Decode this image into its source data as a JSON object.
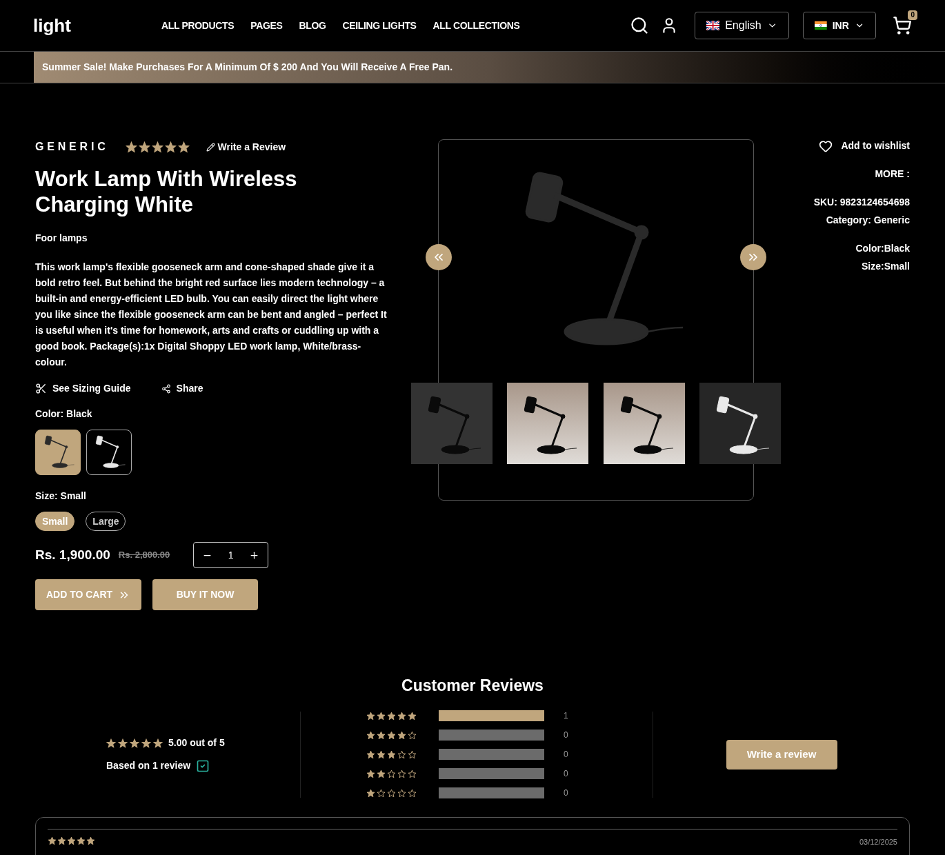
{
  "header": {
    "logo": "light",
    "nav": [
      "ALL PRODUCTS",
      "PAGES",
      "BLOG",
      "CEILING LIGHTS",
      "ALL COLLECTIONS"
    ],
    "language": "English",
    "currency": "INR",
    "cart_count": "0"
  },
  "announcement": "Summer Sale! Make Purchases For A Minimum Of $ 200 And You Will Receive A Free Pan.",
  "product": {
    "brand": "GENERIC",
    "stars": 5,
    "write_review": "Write a Review",
    "title": "Work Lamp With Wireless Charging White",
    "category": "Foor lamps",
    "description": "This work lamp's flexible gooseneck arm and cone-shaped shade give it a bold retro feel. But behind the bright red surface lies modern technology – a built-in and energy-efficient LED bulb. You can easily direct the light where you like since the flexible gooseneck arm can be bent and angled – perfect It is useful when it's time for homework, arts and crafts or cuddling up with a good book. Package(s):1x Digital Shoppy LED work lamp, White/brass-colour.",
    "sizing_guide": "See Sizing Guide",
    "share": "Share",
    "color_label": "Color: Black",
    "swatches": [
      {
        "color": "#2a2a2a",
        "selected": true
      },
      {
        "color": "#e8e8e8",
        "selected": false
      }
    ],
    "size_label": "Size: Small",
    "sizes": [
      {
        "label": "Small",
        "selected": true
      },
      {
        "label": "Large",
        "selected": false
      }
    ],
    "price": "Rs. 1,900.00",
    "compare_price": "Rs. 2,800.00",
    "quantity": "1",
    "add_to_cart": "ADD TO CART",
    "buy_now": "BUY IT NOW"
  },
  "gallery": {
    "thumbnails": [
      {
        "kind": "dark"
      },
      {
        "kind": "room"
      },
      {
        "kind": "room"
      },
      {
        "kind": "white"
      }
    ]
  },
  "details": {
    "wishlist": "Add to wishlist",
    "more": "MORE :",
    "lines": [
      "SKU: 9823124654698",
      "Category: Generic"
    ],
    "options": [
      "Color:Black",
      "Size:Small"
    ]
  },
  "reviews": {
    "title": "Customer Reviews",
    "stars": 5,
    "average": "5.00 out of 5",
    "based_on": "Based on 1 review",
    "bars": [
      {
        "stars": 5,
        "level": 1,
        "count": "1"
      },
      {
        "stars": 4,
        "level": 0,
        "count": "0"
      },
      {
        "stars": 3,
        "level": 0,
        "count": "0"
      },
      {
        "stars": 2,
        "level": 0,
        "count": "0"
      },
      {
        "stars": 1,
        "level": 0,
        "count": "0"
      }
    ],
    "write": "Write a review",
    "items": [
      {
        "stars": 5,
        "date": "03/12/2025"
      }
    ]
  }
}
